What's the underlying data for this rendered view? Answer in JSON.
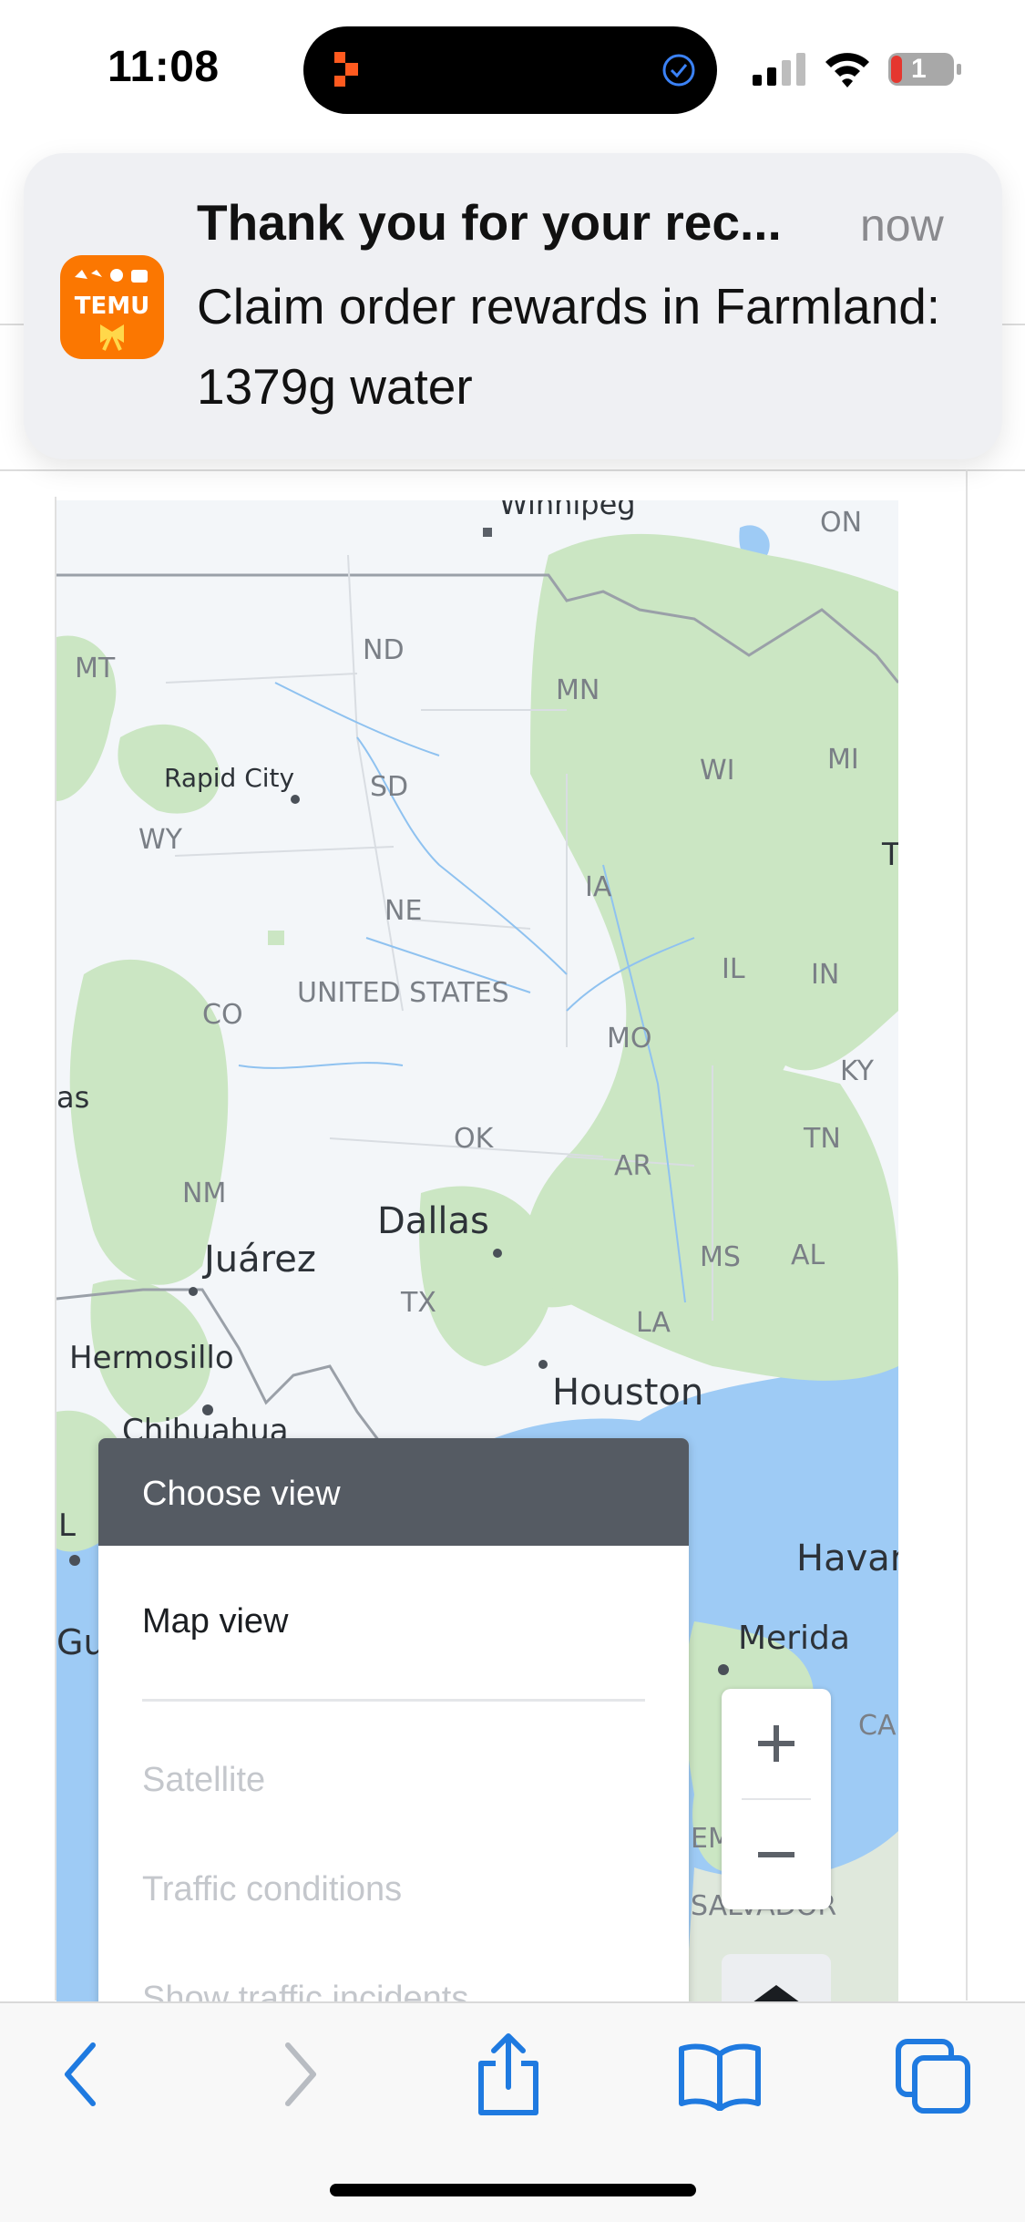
{
  "status_bar": {
    "time": "11:08",
    "battery_level": "1",
    "icons": [
      "app-activity-icon",
      "checkmark-circle-icon",
      "signal-icon",
      "wifi-icon",
      "battery-icon"
    ]
  },
  "notification": {
    "app_name": "TEMU",
    "title": "Thank you for your rec...",
    "time": "now",
    "body": "Claim order rewards in Farmland: 1379g water",
    "icon_color": "#fb7701"
  },
  "map": {
    "labels": {
      "winnipeg": "Winnipeg",
      "on": "ON",
      "mt": "MT",
      "nd": "ND",
      "mn": "MN",
      "rapid_city": "Rapid City",
      "sd": "SD",
      "wi": "WI",
      "mi": "MI",
      "wy": "WY",
      "t": "T",
      "ia": "IA",
      "ne": "NE",
      "il": "IL",
      "in": "IN",
      "united_states": "UNITED STATES",
      "co": "CO",
      "mo": "MO",
      "ky": "KY",
      "as": "as",
      "ok": "OK",
      "tn": "TN",
      "ar": "AR",
      "nm": "NM",
      "dallas": "Dallas",
      "juarez": "Juárez",
      "ms": "MS",
      "al": "AL",
      "tx": "TX",
      "la": "LA",
      "hermosillo": "Hermosillo",
      "houston": "Houston",
      "chihuahua": "Chihuahua",
      "l": "L",
      "havana": "Havar",
      "gu": "Gu",
      "merida": "Merida",
      "ca": "CA",
      "em": "EM",
      "salvador": "SALVADOR"
    },
    "colors": {
      "water": "#9ecbf5",
      "land": "#f3f6f9",
      "forest": "#cbe6c3",
      "border": "#9aa0a8"
    },
    "zoom_in": "+",
    "zoom_out": "−"
  },
  "view_chooser": {
    "title": "Choose view",
    "options": [
      "Map view",
      "Satellite",
      "Traffic conditions",
      "Show traffic incidents"
    ]
  },
  "toolbar": {
    "icons": [
      "back-icon",
      "forward-icon",
      "share-icon",
      "bookmarks-icon",
      "tabs-icon"
    ]
  }
}
